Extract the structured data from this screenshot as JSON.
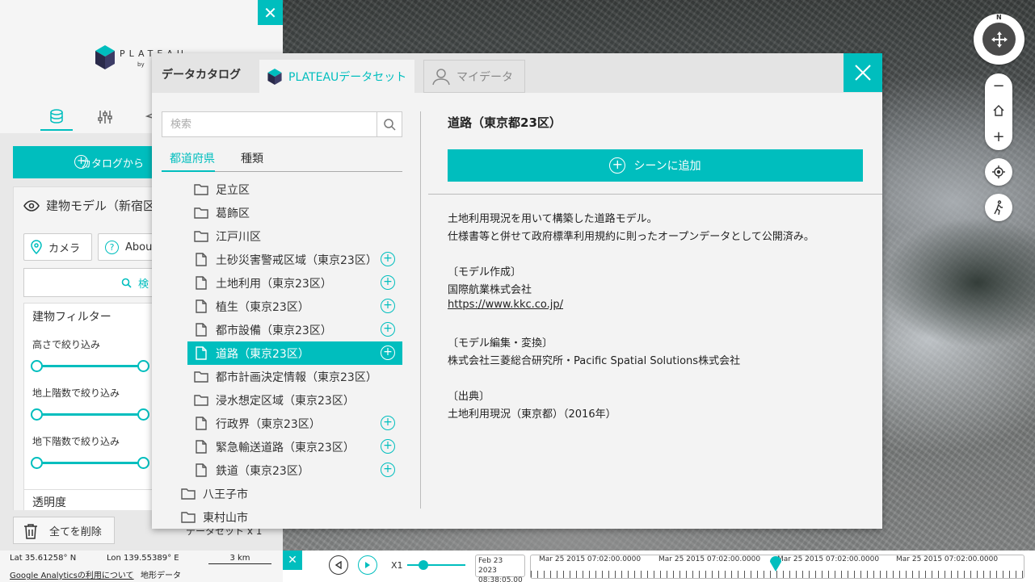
{
  "left_panel": {
    "logo_text": "PLATEAU",
    "logo_by": "by",
    "add_catalog_label": "カタログから",
    "layer_title": "建物モデル（新宿区",
    "camera_label": "カメラ",
    "about_label": "Abou",
    "search_label": "検",
    "filter_title": "建物フィルター",
    "filters": [
      "高さで絞り込み",
      "地上階数で絞り込み",
      "地下階数で絞り込み"
    ],
    "opacity_label": "透明度",
    "delete_all_label": "全てを削除",
    "dataset_count": "データセット x 1"
  },
  "status_bar": {
    "lat": "Lat  35.61258° N",
    "lon": "Lon  139.55389° E",
    "scale": "3 km",
    "ga_link": "Google Analyticsの利用について",
    "terrain": "地形データ"
  },
  "timeline": {
    "speed": "X1",
    "current_date_line1": "Feb 23 2023",
    "current_date_line2": "08:38:05.00",
    "tick_labels": [
      "Mar 25 2015 07:02:00.0000",
      "Mar 25 2015 07:02:00.0000",
      "Mar 25 2015 07:02:00.0000",
      "Mar 25 2015 07:02:00.0000"
    ]
  },
  "nav": {
    "compass_n": "N",
    "zoom_out": "−",
    "zoom_in": "+"
  },
  "modal": {
    "header_title": "データカタログ",
    "tab_plateau": "PLATEAUデータセット",
    "tab_mydata": "マイデータ",
    "search_placeholder": "検索",
    "subtab_prefecture": "都道府県",
    "subtab_type": "種類",
    "tree": [
      {
        "label": "足立区",
        "kind": "folder",
        "addable": false
      },
      {
        "label": "葛飾区",
        "kind": "folder",
        "addable": false
      },
      {
        "label": "江戸川区",
        "kind": "folder",
        "addable": false
      },
      {
        "label": "土砂災害警戒区域（東京23区）",
        "kind": "file",
        "addable": true
      },
      {
        "label": "土地利用（東京23区）",
        "kind": "file",
        "addable": true
      },
      {
        "label": "植生（東京23区）",
        "kind": "file",
        "addable": true
      },
      {
        "label": "都市設備（東京23区）",
        "kind": "file",
        "addable": true
      },
      {
        "label": "道路（東京23区）",
        "kind": "file",
        "addable": true,
        "selected": true
      },
      {
        "label": "都市計画決定情報（東京23区）",
        "kind": "folder",
        "addable": false
      },
      {
        "label": "浸水想定区域（東京23区）",
        "kind": "folder",
        "addable": false
      },
      {
        "label": "行政界（東京23区）",
        "kind": "file",
        "addable": true
      },
      {
        "label": "緊急輸送道路（東京23区）",
        "kind": "file",
        "addable": true
      },
      {
        "label": "鉄道（東京23区）",
        "kind": "file",
        "addable": true
      },
      {
        "label": "八王子市",
        "kind": "folder",
        "addable": false,
        "level": 0
      },
      {
        "label": "東村山市",
        "kind": "folder",
        "addable": false,
        "level": 0
      }
    ],
    "detail": {
      "title": "道路（東京都23区）",
      "add_scene_label": "シーンに追加",
      "lines": [
        "土地利用現況を用いて構築した道路モデル。",
        "仕様書等と併せて政府標準利用規約に則ったオープンデータとして公開済み。",
        "",
        "〔モデル作成〕",
        "国際航業株式会社",
        "https://www.kkc.co.jp/",
        "",
        "〔モデル編集・変換〕",
        "株式会社三菱総合研究所・Pacific Spatial Solutions株式会社",
        "",
        "〔出典〕",
        "土地利用現況（東京都）（2016年）"
      ]
    }
  },
  "colors": {
    "accent": "#00bebe",
    "panel_bg": "#f3f3f3",
    "header_bg": "#e4e4e4"
  }
}
